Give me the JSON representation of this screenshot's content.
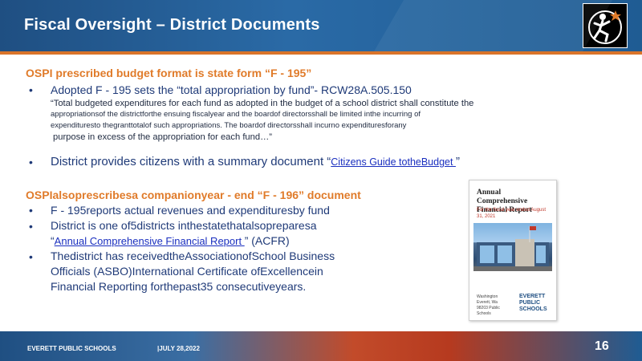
{
  "header": {
    "title": "Fiscal        Oversight            –  District          Documents"
  },
  "section1": {
    "heading": "OSPI prescribed budget format is state form “F                                   - 195”",
    "bullet1": "Adopted     F - 195 sets the “total appropriation by fund”-  RCW28A.505.150",
    "quote_line1": "“Total budgeted expenditures for each fund as adopted in the budget of a school district shall constitute the",
    "quote_line2": "appropriationsof          the districtforthe        ensuing     fiscalyear     and the boardof    directorsshall      be limited     inthe    incurring      of",
    "quote_line3": "expendituresto           thegranttotalof           such  appropriations.           The boardof   directorsshall       incurno    expendituresforany",
    "quote_line4": "purpose in excess of the appropriation for each fund…”",
    "bullet2_prefix": "District provides citizens with a summary document “",
    "bullet2_link": "Citizens      Guide      totheBudget          ",
    "bullet2_suffix": "”"
  },
  "section2": {
    "heading": "OSPIalsoprescribesa                   companionyear                     - end “F      - 196” document",
    "bullet1": "F - 195reports      actual     revenues      and    expendituresby          fund",
    "bullet2_line1": "District     is  one    of5districts         inthestatethatalsopreparesa",
    "bullet2_link": "Annual     Comprehensive          Financial     Report  ",
    "bullet2_suffix": " (ACFR)",
    "bullet3_line1": "Thedistrict        has   receivedtheAssociationofSchool                     Business",
    "bullet3_line2": "Officials    (ASBO)International          Certificate     ofExcellencein",
    "bullet3_line3": "Financial      Reporting       forthepast35          consecutiveyears."
  },
  "cover": {
    "title": "Annual Comprehensive Financial Report",
    "subtitle": "For the fiscal year ended August 31, 2021",
    "footer": "Washington Everett, Wa 98203 Public Schools",
    "logo": "EVERETT PUBLIC SCHOOLS"
  },
  "footer": {
    "org": "EVERETT        PUBLIC SCHOOLS",
    "date": "|JULY     28,2022",
    "page": "16"
  },
  "colors": {
    "header": "#1f4f82",
    "accent_orange": "#e07b2a",
    "text_blue": "#1f3a78",
    "link": "#1a2fbf"
  }
}
